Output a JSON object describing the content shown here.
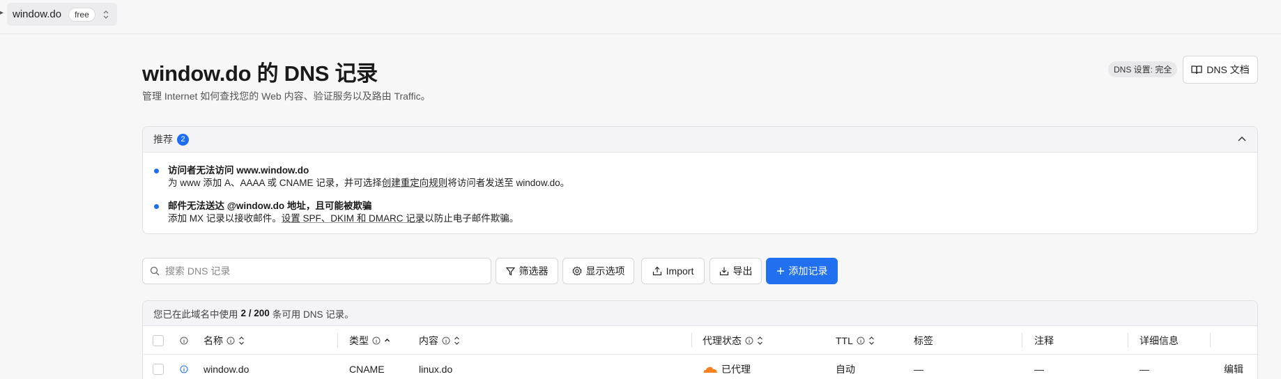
{
  "topbar": {
    "zone_name": "window.do",
    "plan": "free"
  },
  "header": {
    "title": "window.do 的 DNS 记录",
    "subtitle": "管理 Internet 如何查找您的 Web 内容、验证服务以及路由 Traffic。",
    "dns_setting_badge": "DNS 设置: 完全",
    "docs_button": "DNS 文档"
  },
  "recommendations": {
    "label": "推荐",
    "count": "2",
    "items": [
      {
        "title": "访问者无法访问 www.window.do",
        "desc_prefix": "为 www 添加 A、AAAA 或 CNAME 记录，并可选择",
        "desc_link": "创建重定向规则",
        "desc_suffix": "将访问者发送至 window.do。"
      },
      {
        "title": "邮件无法送达 @window.do 地址，且可能被欺骗",
        "desc_prefix": "添加 MX 记录以接收邮件。",
        "desc_link": "设置 SPF、DKIM 和 DMARC 记录",
        "desc_suffix": "以防止电子邮件欺骗。"
      }
    ]
  },
  "toolbar": {
    "search_placeholder": "搜索 DNS 记录",
    "filter": "筛选器",
    "display_options": "显示选项",
    "import": "Import",
    "export": "导出",
    "add_record": "添加记录"
  },
  "table": {
    "usage_prefix": "您已在此域名中使用",
    "usage_count": "2 / 200",
    "usage_suffix": "条可用 DNS 记录。",
    "columns": {
      "name": "名称",
      "type": "类型",
      "content": "内容",
      "proxy": "代理状态",
      "ttl": "TTL",
      "tags": "标签",
      "comment": "注释",
      "details": "详细信息"
    },
    "rows": [
      {
        "name": "window.do",
        "type": "CNAME",
        "content": "linux.do",
        "proxy": "已代理",
        "ttl": "自动",
        "tags": "—",
        "comment": "—",
        "details": "—",
        "action": "编辑"
      }
    ]
  },
  "colors": {
    "accent": "#2070f0",
    "cloud": "#f6821f"
  }
}
